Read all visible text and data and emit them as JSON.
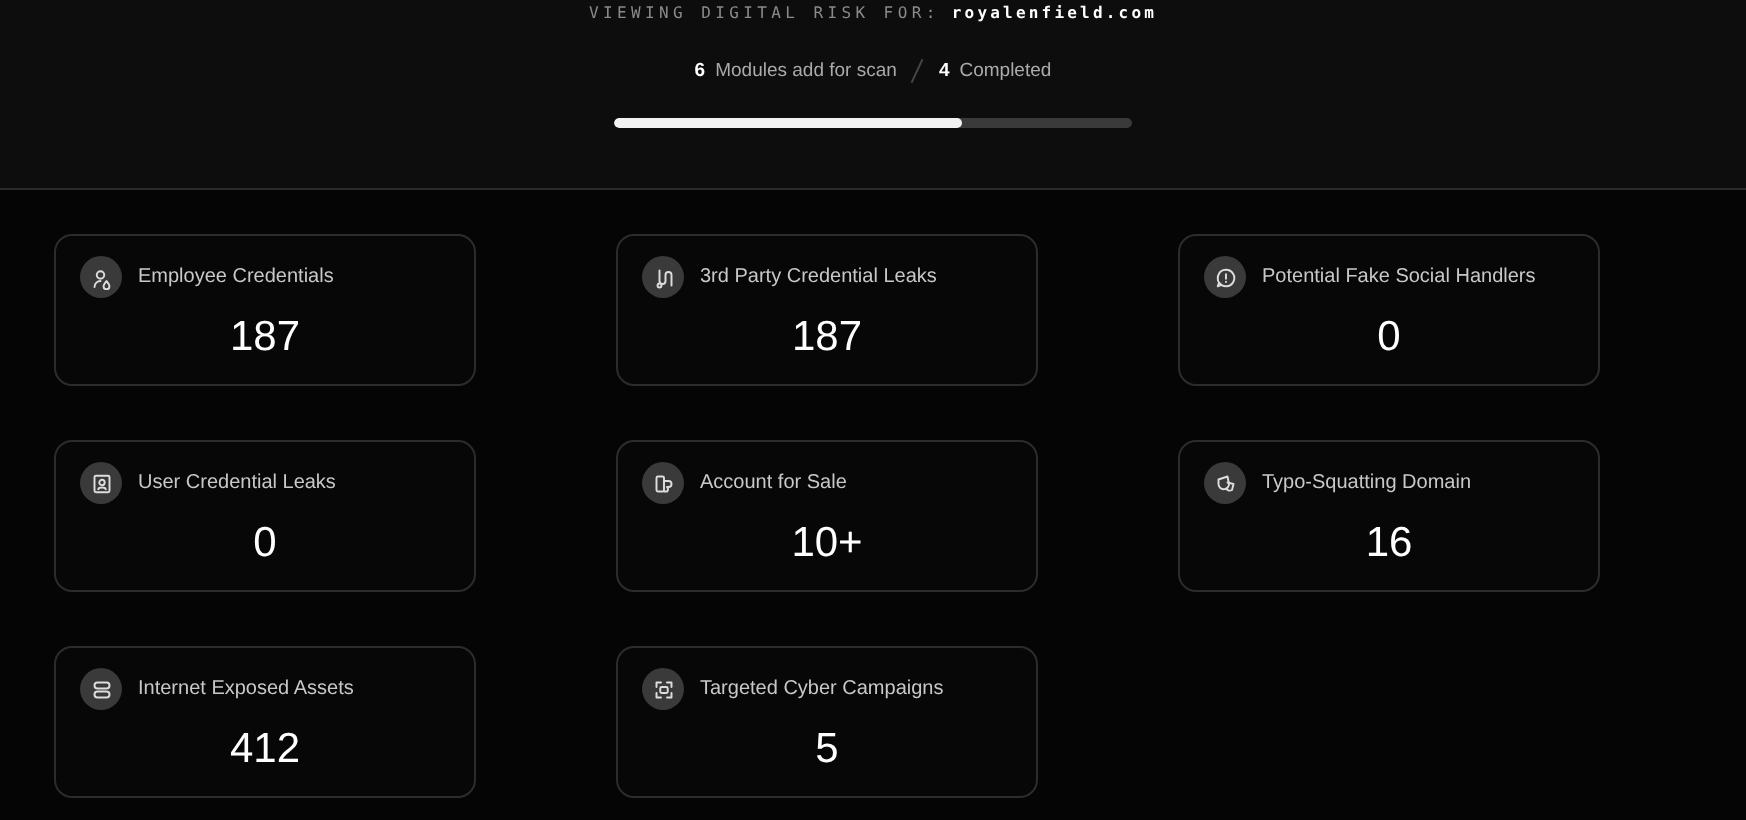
{
  "header": {
    "label": "VIEWING DIGITAL RISK FOR:",
    "domain": "royalenfield.com",
    "modules_count": "6",
    "modules_label": "Modules add for scan",
    "completed_count": "4",
    "completed_label": "Completed",
    "progress": {
      "level": 0.67
    }
  },
  "cards": [
    {
      "title": "Employee Credentials",
      "value": "187"
    },
    {
      "title": "3rd Party Credential Leaks",
      "value": "187"
    },
    {
      "title": "Potential Fake Social Handlers",
      "value": "0"
    },
    {
      "title": "User Credential Leaks",
      "value": "0"
    },
    {
      "title": "Account for Sale",
      "value": "10+"
    },
    {
      "title": "Typo-Squatting Domain",
      "value": "16"
    },
    {
      "title": "Internet Exposed Assets",
      "value": "412"
    },
    {
      "title": "Targeted Cyber Campaigns",
      "value": "5"
    }
  ]
}
